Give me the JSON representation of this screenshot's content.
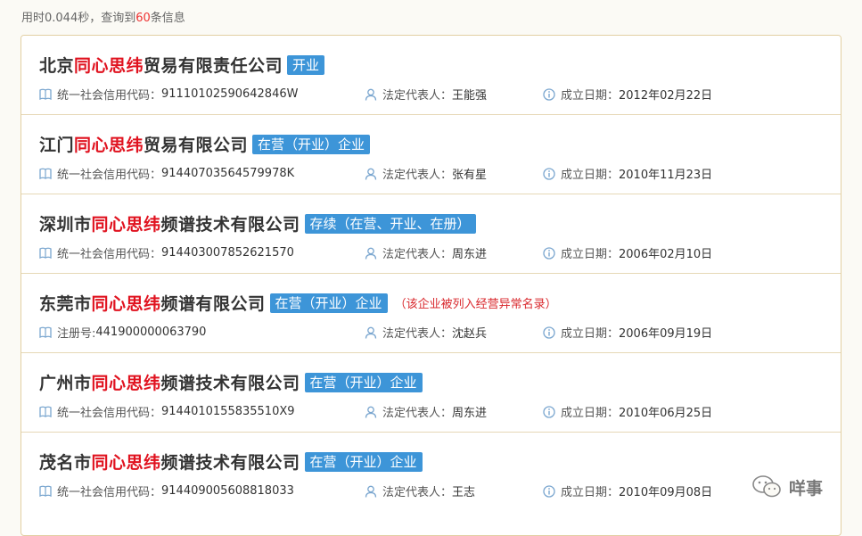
{
  "summary": {
    "prefix": "用时0.044秒，查询到",
    "count": "60",
    "suffix": "条信息"
  },
  "labels": {
    "credit_code": "统一社会信用代码：",
    "reg_no": "注册号: ",
    "legal_rep": "法定代表人：",
    "founded": "成立日期："
  },
  "companies": [
    {
      "pre": "北京",
      "hl": "同心思纬",
      "post": "贸易有限责任公司",
      "status": "开业",
      "warn": "",
      "code_label": "统一社会信用代码：",
      "code": "91110102590642846W",
      "rep": "王能强",
      "date": "2012年02月22日"
    },
    {
      "pre": "江门",
      "hl": "同心思纬",
      "post": "贸易有限公司",
      "status": "在营（开业）企业",
      "warn": "",
      "code_label": "统一社会信用代码：",
      "code": "91440703564579978K",
      "rep": "张有星",
      "date": "2010年11月23日"
    },
    {
      "pre": "深圳市",
      "hl": "同心思纬",
      "post": "频谱技术有限公司",
      "status": "存续（在营、开业、在册）",
      "warn": "",
      "code_label": "统一社会信用代码：",
      "code": "914403007852621570",
      "rep": "周东进",
      "date": "2006年02月10日"
    },
    {
      "pre": "东莞市",
      "hl": "同心思纬",
      "post": "频谱有限公司",
      "status": "在营（开业）企业",
      "warn": "（该企业被列入经营异常名录）",
      "code_label": "注册号: ",
      "code": "441900000063790",
      "rep": "沈赵兵",
      "date": "2006年09月19日"
    },
    {
      "pre": "广州市",
      "hl": "同心思纬",
      "post": "频谱技术有限公司",
      "status": "在营（开业）企业",
      "warn": "",
      "code_label": "统一社会信用代码：",
      "code": "9144010155835510X9",
      "rep": "周东进",
      "date": "2010年06月25日"
    },
    {
      "pre": "茂名市",
      "hl": "同心思纬",
      "post": "频谱技术有限公司",
      "status": "在营（开业）企业",
      "warn": "",
      "code_label": "统一社会信用代码：",
      "code": "914409005608818033",
      "rep": "王志",
      "date": "2010年09月08日"
    }
  ],
  "watermark": {
    "text": "咩事",
    "icon": "wechat-icon"
  },
  "colors": {
    "highlight": "#e0121f",
    "status_bg": "#3d95d8",
    "warn": "#d9282d",
    "border": "#e2cfa3"
  },
  "icons": {
    "code": "book-icon",
    "rep": "user-icon",
    "date": "info-icon"
  }
}
